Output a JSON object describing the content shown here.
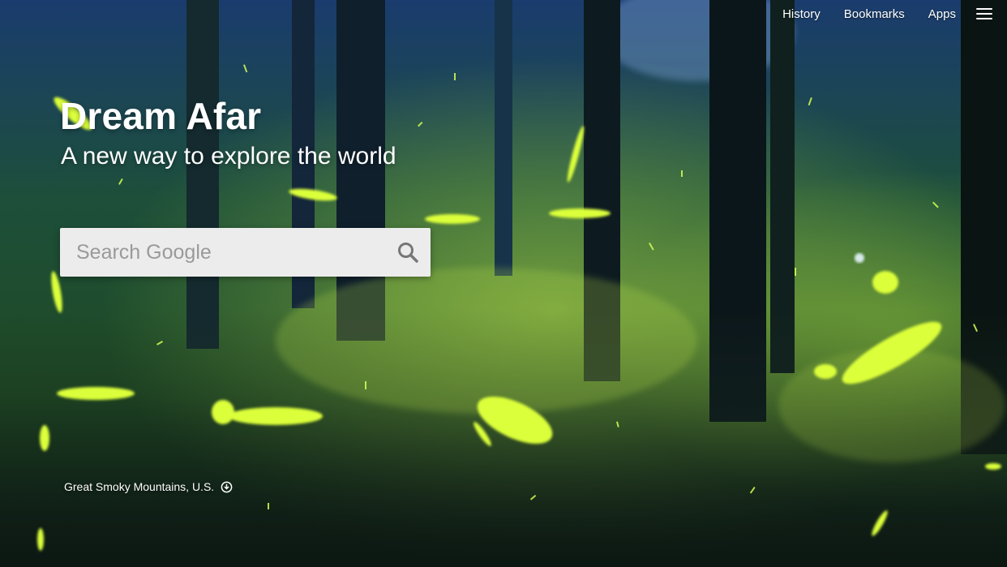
{
  "nav": {
    "history_label": "History",
    "bookmarks_label": "Bookmarks",
    "apps_label": "Apps",
    "menu_icon": "hamburger-menu-icon"
  },
  "hero": {
    "title": "Dream Afar",
    "subtitle": "A new way to explore the world"
  },
  "search": {
    "placeholder": "Search Google",
    "value": "",
    "icon": "search-icon"
  },
  "photo": {
    "location": "Great Smoky Mountains, U.S.",
    "info_icon": "download-circle-icon"
  },
  "colors": {
    "text": "#ffffff",
    "search_bg": "#ececec",
    "placeholder": "#9a9a9a",
    "firefly": "#d8ff3a",
    "forest_dark": "#0b1a14",
    "forest_blue": "#1d3a7a"
  }
}
